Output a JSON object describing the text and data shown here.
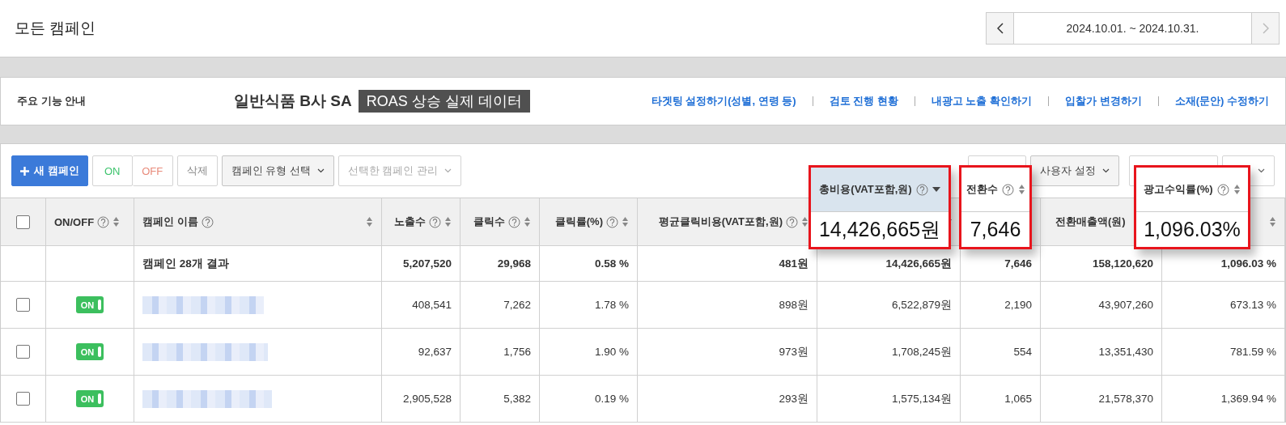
{
  "header": {
    "title": "모든 캠페인",
    "date_range": "2024.10.01. ~ 2024.10.31."
  },
  "guide": {
    "label": "주요 기능 안내",
    "headline": "일반식품 B사 SA",
    "tag": "ROAS 상승 실제 데이터",
    "links": [
      "타겟팅 설정하기(성별, 연령 등)",
      "검토 진행 현황",
      "내광고 노출 확인하기",
      "입찰가 변경하기",
      "소재(문안) 수정하기"
    ]
  },
  "toolbar": {
    "new_button": "새 캠페인",
    "toggle": [
      {
        "label": "ON",
        "kind": "on"
      },
      {
        "label": "OFF",
        "kind": "off"
      }
    ],
    "delete_button": "삭제",
    "selects": [
      {
        "label": "캠페인 유형 선택",
        "disabled": false
      },
      {
        "label": "선택한 캠페인 관리",
        "disabled": true
      }
    ],
    "custom_settings": "사용자 설정"
  },
  "table": {
    "header_checked": false,
    "columns": [
      {
        "label": "ON/OFF",
        "help": true,
        "sorted": false
      },
      {
        "label": "캠페인 이름",
        "help": true,
        "sorted": false
      },
      {
        "label": "노출수",
        "help": true,
        "sorted": false
      },
      {
        "label": "클릭수",
        "help": true,
        "sorted": false
      },
      {
        "label": "클릭률(%)",
        "help": true,
        "sorted": false
      },
      {
        "label": "평균클릭비용(VAT포함,원)",
        "help": true,
        "sorted": false
      },
      {
        "sorted": true
      },
      {},
      {
        "label": "전환매출액(원)"
      },
      {
        "sorted": false
      }
    ],
    "summary": {
      "label": "캠페인 28개 결과",
      "values": [
        "5,207,520",
        "29,968",
        "0.58 %",
        "481원",
        "14,426,665원",
        "7,646",
        "158,120,620",
        "1,096.03 %"
      ]
    },
    "rows": [
      {
        "checked": false,
        "on": true,
        "toggle_label": "ON",
        "values": [
          "408,541",
          "7,262",
          "1.78 %",
          "898원",
          "6,522,879원",
          "2,190",
          "43,907,260",
          "673.13 %"
        ]
      },
      {
        "checked": false,
        "on": true,
        "toggle_label": "ON",
        "values": [
          "92,637",
          "1,756",
          "1.90 %",
          "973원",
          "1,708,245원",
          "554",
          "13,351,430",
          "781.59 %"
        ]
      },
      {
        "checked": false,
        "on": true,
        "toggle_label": "ON",
        "values": [
          "2,905,528",
          "5,382",
          "0.19 %",
          "293원",
          "1,575,134원",
          "1,065",
          "21,578,370",
          "1,369.94 %"
        ]
      }
    ]
  },
  "callouts": [
    {
      "label": "총비용(VAT포함,원)",
      "sorted": true,
      "value": "14,426,665원",
      "highlighted": true
    },
    {
      "label": "전환수",
      "sorted": false,
      "value": "7,646",
      "highlighted": false
    },
    {
      "label": "광고수익률(%)",
      "sorted": false,
      "value": "1,096.03%",
      "highlighted": false
    }
  ]
}
